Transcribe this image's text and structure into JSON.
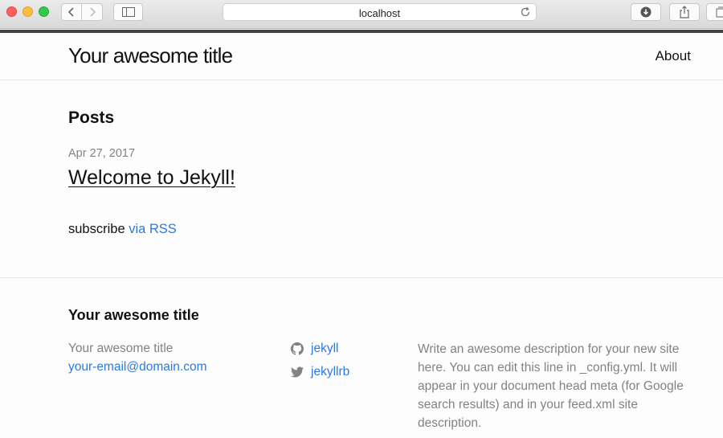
{
  "browser": {
    "address": "localhost",
    "icons": {
      "back": "chevron-left-icon",
      "forward": "chevron-right-icon",
      "sidebar": "sidebar-icon",
      "reload": "reload-icon",
      "download": "download-icon",
      "share": "share-icon",
      "tabs": "tabs-icon"
    }
  },
  "header": {
    "site_title": "Your awesome title",
    "nav_about": "About"
  },
  "main": {
    "heading": "Posts",
    "posts": [
      {
        "date": "Apr 27, 2017",
        "title": "Welcome to Jekyll!"
      }
    ],
    "subscribe_text": "subscribe ",
    "subscribe_link": "via RSS"
  },
  "footer": {
    "heading": "Your awesome title",
    "name": "Your awesome title",
    "email": "your-email@domain.com",
    "github": "jekyll",
    "twitter": "jekyllrb",
    "description": "Write an awesome description for your new site here. You can edit this line in _config.yml. It will appear in your document head meta (for Google search results) and in your feed.xml site description."
  },
  "colors": {
    "link": "#2a7ae2",
    "muted": "#828282",
    "text": "#111111",
    "header_bar": "#424242"
  }
}
